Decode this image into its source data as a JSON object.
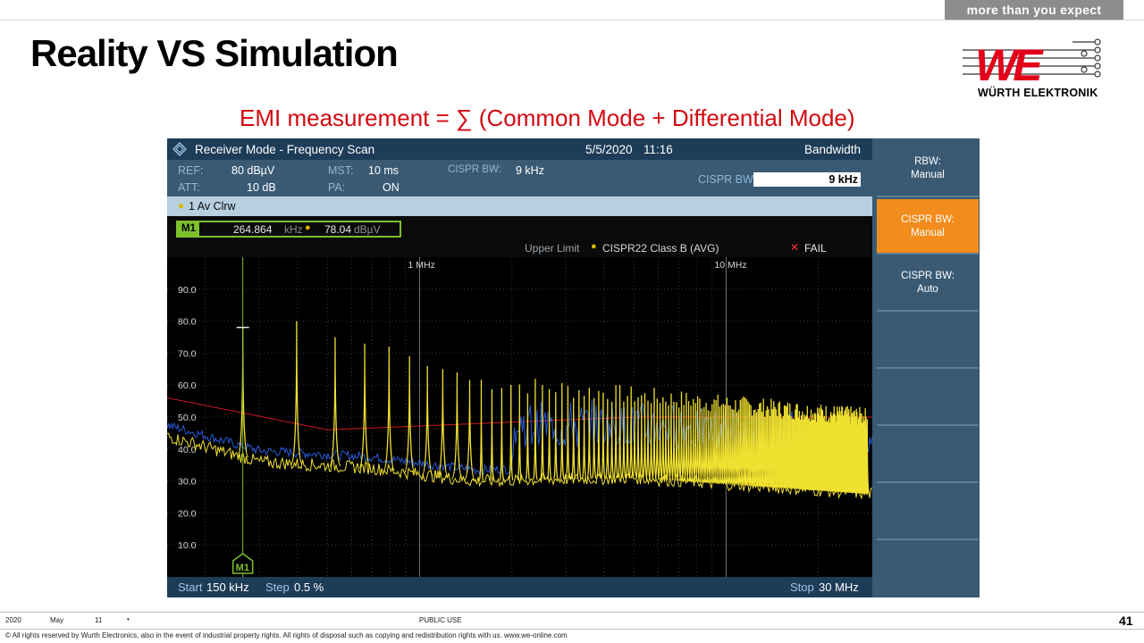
{
  "slide": {
    "tagline": "more than you expect",
    "title": "Reality VS Simulation",
    "formula": "EMI measurement = ∑ (Common Mode + Differential Mode)",
    "logo_text": "WÜRTH ELEKTRONIK",
    "footer": {
      "year": "2020",
      "month": "May",
      "day": "11",
      "bullet": "•",
      "classification": "PUBLIC USE",
      "page": "41",
      "copyright": "© All rights reserved by Wurth Electronics, also in the event of industrial property rights. All rights of disposal such as copying and redistribution rights with us. www.we-online.com"
    }
  },
  "analyzer": {
    "mode": "Receiver Mode - Frequency Scan",
    "date": "5/5/2020",
    "time": "11:16",
    "panel_title": "Bandwidth",
    "ref_label": "REF:",
    "ref_value": "80 dBµV",
    "att_label": "ATT:",
    "att_value": "10 dB",
    "mst_label": "MST:",
    "mst_value": "10 ms",
    "pa_label": "PA:",
    "pa_value": "ON",
    "cispr_bw_label": "CISPR BW:",
    "cispr_bw_value": "9 kHz",
    "cispr_field_label": "CISPR BW",
    "cispr_field_value": "9 kHz",
    "trace": "1 Av  Clrw",
    "marker": {
      "id": "M1",
      "freq": "264.864",
      "freq_unit": "kHz",
      "level": "78.04",
      "level_unit": "dBµV",
      "badge": "M1"
    },
    "limit_label": "Upper Limit",
    "limit_name": "CISPR22 Class B (AVG)",
    "fail_mark": "✕",
    "fail_text": "FAIL",
    "start_label": "Start",
    "start_value": "150 kHz",
    "step_label": "Step",
    "step_value": "0.5 %",
    "stop_label": "Stop",
    "stop_value": "30 MHz",
    "softkeys": [
      {
        "line1": "RBW:",
        "line2": "Manual",
        "active": false
      },
      {
        "line1": "CISPR BW:",
        "line2": "Manual",
        "active": true
      },
      {
        "line1": "CISPR BW:",
        "line2": "Auto",
        "active": false
      }
    ],
    "colors": {
      "trace_avg": "#f0e030",
      "trace_peak": "#2a5ad8",
      "limit": "#d01a1a",
      "accent": "#f28c1c",
      "header": "#1d3c58"
    }
  },
  "chart_data": {
    "type": "line",
    "title": "",
    "xlabel": "",
    "ylabel": "",
    "x_scale": "log",
    "xlim": [
      150000,
      30000000
    ],
    "ylim": [
      0,
      100
    ],
    "y_ticks": [
      "90.0",
      "80.0",
      "70.0",
      "60.0",
      "50.0",
      "40.0",
      "30.0",
      "20.0",
      "10.0"
    ],
    "x_ticks": [
      {
        "label": "1 MHz",
        "value": 1000000
      },
      {
        "label": "10 MHz",
        "value": 10000000
      }
    ],
    "grid": true,
    "series": [
      {
        "name": "CISPR22 Class B (AVG)",
        "x": [
          150000,
          500000,
          5000000,
          30000000
        ],
        "y": [
          56,
          46,
          50,
          50
        ]
      },
      {
        "name": "1 Av Clrw",
        "peaks_x": [
          264864,
          397000,
          530000,
          662000,
          795000,
          927000,
          1060000,
          1190000,
          1325000
        ],
        "peaks_y": [
          78.04,
          80,
          75,
          73,
          72,
          69,
          66,
          65,
          64
        ],
        "floor_x": [
          150000,
          300000,
          700000,
          1500000,
          5000000,
          30000000
        ],
        "floor_y": [
          44,
          36,
          34,
          30,
          31,
          26
        ]
      }
    ]
  }
}
